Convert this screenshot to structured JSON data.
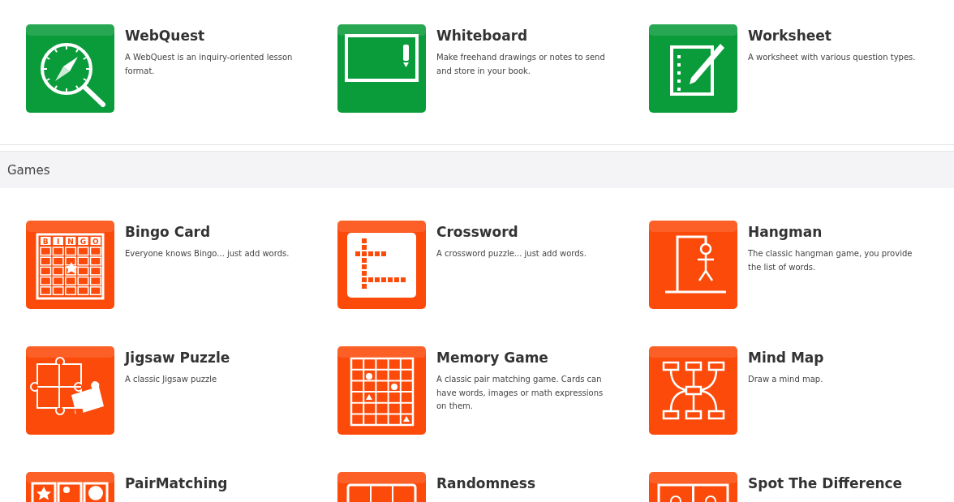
{
  "sections": [
    {
      "items": [
        {
          "title": "WebQuest",
          "description": "A WebQuest is an inquiry-oriented lesson format.",
          "kind": "compass",
          "color": "#0a9b3a"
        },
        {
          "title": "Whiteboard",
          "description": "Make freehand drawings or notes to send and store in your book.",
          "kind": "whiteboard",
          "color": "#0a9b3a"
        },
        {
          "title": "Worksheet",
          "description": "A worksheet with various question types.",
          "kind": "worksheet",
          "color": "#0a9b3a"
        }
      ]
    },
    {
      "title": "Games",
      "items": [
        {
          "title": "Bingo Card",
          "description": "Everyone knows Bingo... just add words.",
          "kind": "bingo",
          "color": "#fc4a0a",
          "icon_letters": [
            "B",
            "I",
            "N",
            "G",
            "O"
          ]
        },
        {
          "title": "Crossword",
          "description": "A crossword puzzle... just add words.",
          "kind": "crossword",
          "color": "#fc4a0a"
        },
        {
          "title": "Hangman",
          "description": "The classic hangman game, you provide the list of words.",
          "kind": "hangman",
          "color": "#fc4a0a"
        },
        {
          "title": "Jigsaw Puzzle",
          "description": "A classic Jigsaw puzzle",
          "kind": "jigsaw",
          "color": "#fc4a0a"
        },
        {
          "title": "Memory Game",
          "description": "A classic pair matching game. Cards can have words, images or math expressions on them.",
          "kind": "memory",
          "color": "#fc4a0a"
        },
        {
          "title": "Mind Map",
          "description": "Draw a mind map.",
          "kind": "mindmap",
          "color": "#fc4a0a"
        },
        {
          "title": "PairMatching",
          "kind": "pairs",
          "color": "#fc4a0a"
        },
        {
          "title": "Randomness",
          "kind": "random",
          "color": "#fc4a0a"
        },
        {
          "title": "Spot The Difference",
          "kind": "spot",
          "color": "#fc4a0a"
        }
      ]
    }
  ]
}
